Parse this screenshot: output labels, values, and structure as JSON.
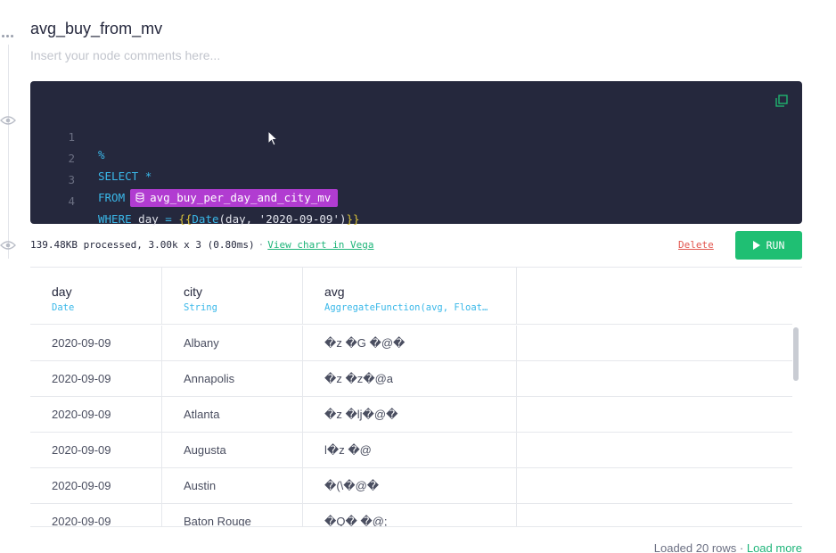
{
  "node": {
    "title": "avg_buy_from_mv",
    "comment_placeholder": "Insert your node comments here..."
  },
  "editor": {
    "lines": [
      {
        "num": "1",
        "pct": "%"
      },
      {
        "num": "2",
        "select": "SELECT",
        "star": "*"
      },
      {
        "num": "3",
        "from": "FROM",
        "pipe": "avg_buy_per_day_and_city_mv"
      },
      {
        "num": "4",
        "where": "WHERE",
        "col": "day",
        "eq": "=",
        "open": "{{",
        "fn": "Date",
        "args_a": "(day, ",
        "str": "'2020-09-09'",
        "args_b": ")",
        "close": "}}"
      }
    ]
  },
  "stats": {
    "text": "139.48KB processed, 3.00k x 3 (0.80ms)",
    "separator": "·",
    "chart_link": "View chart in Vega"
  },
  "actions": {
    "delete_label": "Delete",
    "run_label": "RUN"
  },
  "table": {
    "columns": [
      {
        "name": "day",
        "type": "Date"
      },
      {
        "name": "city",
        "type": "String"
      },
      {
        "name": "avg",
        "type": "AggregateFunction(avg, Float…"
      }
    ],
    "rows": [
      [
        "2020-09-09",
        "Albany",
        "�z �G �@�"
      ],
      [
        "2020-09-09",
        "Annapolis",
        "�z �z�@a"
      ],
      [
        "2020-09-09",
        "Atlanta",
        "�z �lj�@�"
      ],
      [
        "2020-09-09",
        "Augusta",
        "l�z �@"
      ],
      [
        "2020-09-09",
        "Austin",
        "�(\\�@�"
      ],
      [
        "2020-09-09",
        "Baton Rouge",
        "�Q� �@;"
      ]
    ]
  },
  "footer": {
    "loaded_text": "Loaded 20 rows",
    "separator": " · ",
    "load_more": "Load more"
  },
  "colors": {
    "editor_bg": "#25283d",
    "keyword": "#3ab8e9",
    "pipe_pill": "#b13cd1",
    "run_button": "#1fbf73",
    "link_green": "#1fb57a",
    "delete_red": "#e2554e"
  }
}
